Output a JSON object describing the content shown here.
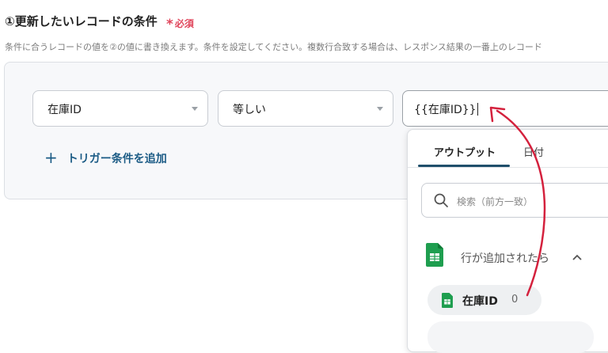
{
  "section": {
    "title": "①更新したいレコードの条件",
    "required_star": "*",
    "required_label": "必須",
    "description": "条件に合うレコードの値を②の値に書き換えます。条件を設定してください。複数行合致する場合は、レスポンス結果の一番上のレコード"
  },
  "condition": {
    "field_value": "在庫ID",
    "operator_value": "等しい",
    "value_text": "{{在庫ID}}",
    "add_label": "トリガー条件を追加"
  },
  "popup": {
    "tabs": [
      "アウトプット",
      "日付"
    ],
    "search_placeholder": "検索（前方一致）",
    "group_label": "行が追加されたら",
    "item_name": "在庫ID",
    "item_value": "0"
  },
  "colors": {
    "accent": "#1f4f6b",
    "required": "#e0465c",
    "arrow": "#d4213d",
    "sheets_green": "#1e9e4f"
  }
}
